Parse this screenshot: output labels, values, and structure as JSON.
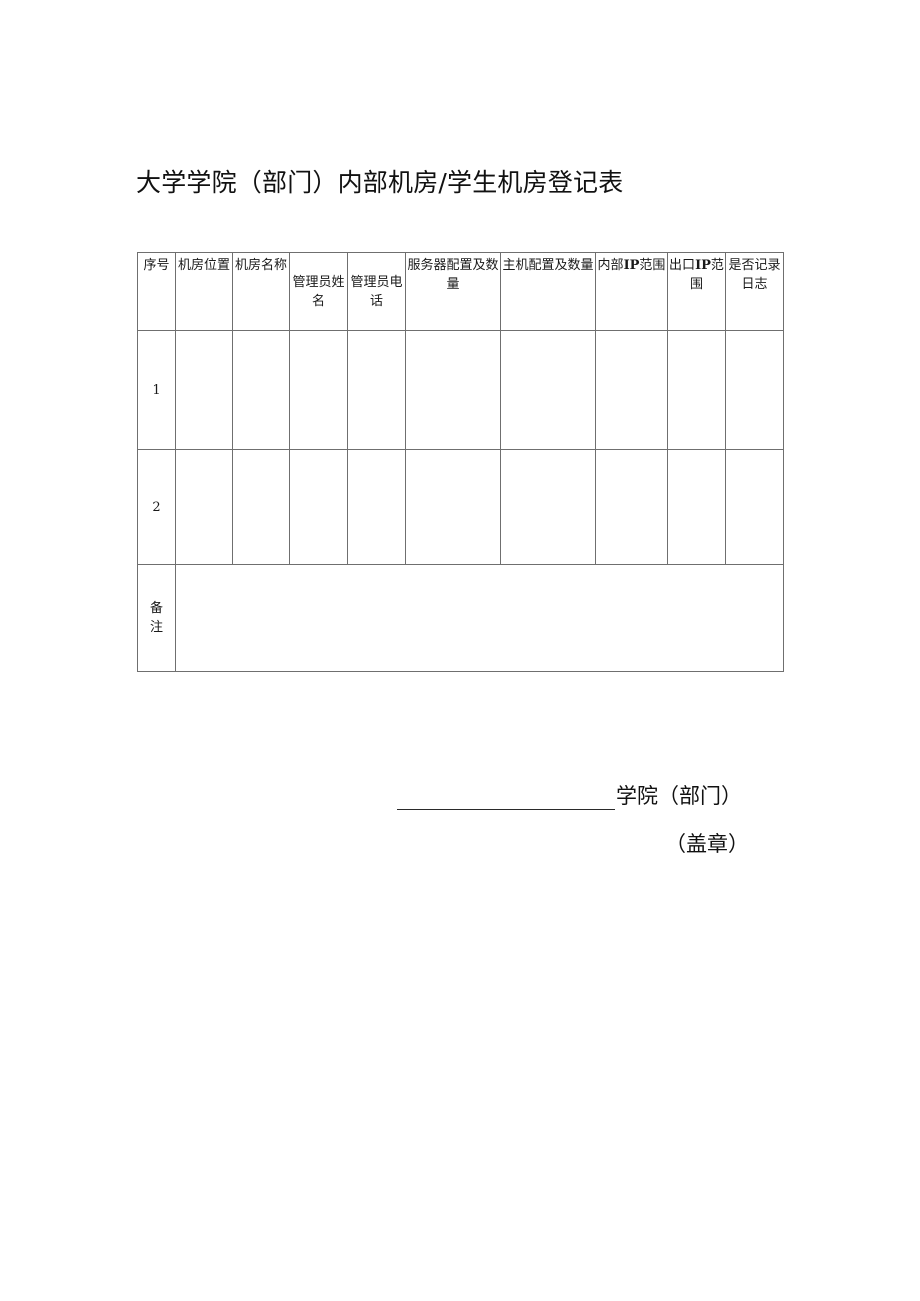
{
  "document": {
    "title": "大学学院（部门）内部机房/学生机房登记表"
  },
  "table": {
    "headers": [
      {
        "key": "seq",
        "label": "序号",
        "align": "top"
      },
      {
        "key": "loc",
        "label": "机房位置",
        "align": "top"
      },
      {
        "key": "name",
        "label": "机房名称",
        "align": "top"
      },
      {
        "key": "mgr",
        "label": "管理员姓名",
        "align": "middle"
      },
      {
        "key": "tel",
        "label": "管理员电话",
        "align": "middle"
      },
      {
        "key": "srv",
        "label": "服务器配置及数量",
        "align": "top"
      },
      {
        "key": "host",
        "label": "主机配置及数量",
        "align": "top"
      },
      {
        "key": "inip",
        "label": "内部IP范围",
        "align": "top"
      },
      {
        "key": "outip",
        "label": "出口IP范围",
        "align": "top"
      },
      {
        "key": "log",
        "label": "是否记录日志",
        "align": "top"
      }
    ],
    "rows": [
      {
        "index": "1",
        "loc": "",
        "name": "",
        "mgr": "",
        "tel": "",
        "srv": "",
        "host": "",
        "inip": "",
        "outip": "",
        "log": ""
      },
      {
        "index": "2",
        "loc": "",
        "name": "",
        "mgr": "",
        "tel": "",
        "srv": "",
        "host": "",
        "inip": "",
        "outip": "",
        "log": ""
      }
    ],
    "note": {
      "label_chars": [
        "备",
        "注"
      ],
      "label": "备注",
      "value": ""
    }
  },
  "footer": {
    "blank_line": "",
    "department_text": "学院（部门）",
    "seal_text": "（盖章）"
  },
  "colors": {
    "text": "#111111",
    "border": "#6f6f6f",
    "background": "#ffffff"
  }
}
